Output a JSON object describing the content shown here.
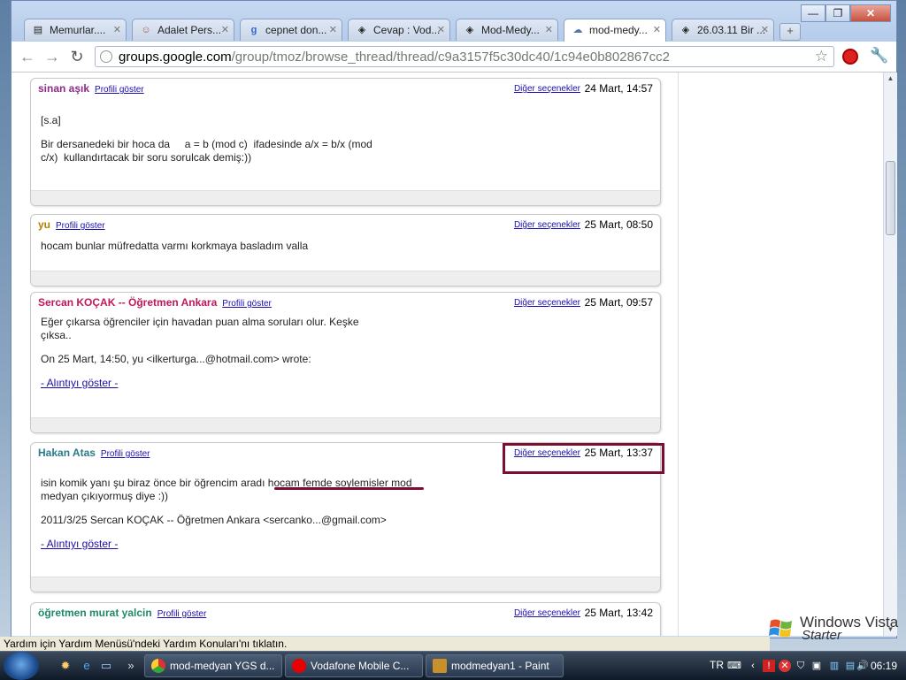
{
  "browser": {
    "tabs": [
      {
        "label": "Memurlar....",
        "icon": "page-icon"
      },
      {
        "label": "Adalet Pers...",
        "icon": "people-icon"
      },
      {
        "label": "cepnet don...",
        "icon": "google-icon"
      },
      {
        "label": "Cevap : Vod...",
        "icon": "diamond-icon"
      },
      {
        "label": "Mod-Medy...",
        "icon": "diamond-icon"
      },
      {
        "label": "mod-medy...",
        "icon": "chat-icon",
        "active": true
      },
      {
        "label": "26.03.11 Bir ...",
        "icon": "diamond-icon"
      }
    ],
    "url_host": "groups.google.com",
    "url_path": "/group/tmoz/browse_thread/thread/c9a3157f5c30dc40/1c94e0b802867cc2"
  },
  "messages": [
    {
      "author": "sinan aşık",
      "author_color": "#8b2b8b",
      "profile_label": "Profili göster",
      "more_label": "Diğer seçenekler",
      "date": "24 Mart, 14:57",
      "lines": [
        "[s.a]",
        "",
        "Bir dersanedeki bir hoca da     a = b (mod c)  ifadesinde a/x = b/x (mod",
        "c/x)  kullandırtacak bir soru sorulcak demiş:))"
      ]
    },
    {
      "author": "yu",
      "author_color": "#b08000",
      "profile_label": "Profili göster",
      "more_label": "Diğer seçenekler",
      "date": "25 Mart, 08:50",
      "lines": [
        "hocam bunlar müfredatta varmı korkmaya basladım valla"
      ]
    },
    {
      "author": "Sercan KOÇAK -- Öğretmen Ankara",
      "author_color": "#c0185a",
      "profile_label": "Profili göster",
      "more_label": "Diğer seçenekler",
      "date": "25 Mart, 09:57",
      "lines": [
        "Eğer çıkarsa öğrenciler için havadan puan alma soruları olur. Keşke",
        "çıksa..",
        "",
        "On 25 Mart, 14:50, yu <ilkerturga...@hotmail.com> wrote:"
      ],
      "quote_link": "- Alıntıyı göster -"
    },
    {
      "author": "Hakan Atas",
      "author_color": "#2a7a8a",
      "profile_label": "Profili göster",
      "more_label": "Diğer seçenekler",
      "date": "25 Mart, 13:37",
      "lines": [
        "isin komik yanı şu biraz önce bir öğrencim aradı hocam femde soylemisler mod",
        "medyan çıkıyormuş diye :))",
        "",
        "2011/3/25 Sercan KOÇAK -- Öğretmen Ankara <sercanko...@gmail.com>"
      ],
      "quote_link": "- Alıntıyı göster -"
    },
    {
      "author": "öğretmen murat yalcin",
      "author_color": "#1e8a6a",
      "profile_label": "Profili göster",
      "more_label": "Diğer seçenekler",
      "date": "25 Mart, 13:42",
      "lines": []
    }
  ],
  "statusbar": {
    "text": "Yardım için Yardım Menüsü'ndeki Yardım Konuları'nı tıklatın."
  },
  "vista_badge": {
    "line1": "Windows Vista",
    "line2": "Starter"
  },
  "taskbar": {
    "buttons": [
      {
        "label": "mod-medyan YGS d...",
        "icon": "chrome-icon"
      },
      {
        "label": "Vodafone Mobile C...",
        "icon": "vodafone-icon"
      },
      {
        "label": "modmedyan1 - Paint",
        "icon": "paint-icon"
      }
    ],
    "language": "TR",
    "clock": "06:19"
  },
  "colors": {
    "highlight": "#7b0f32",
    "link": "#1a0dab"
  }
}
